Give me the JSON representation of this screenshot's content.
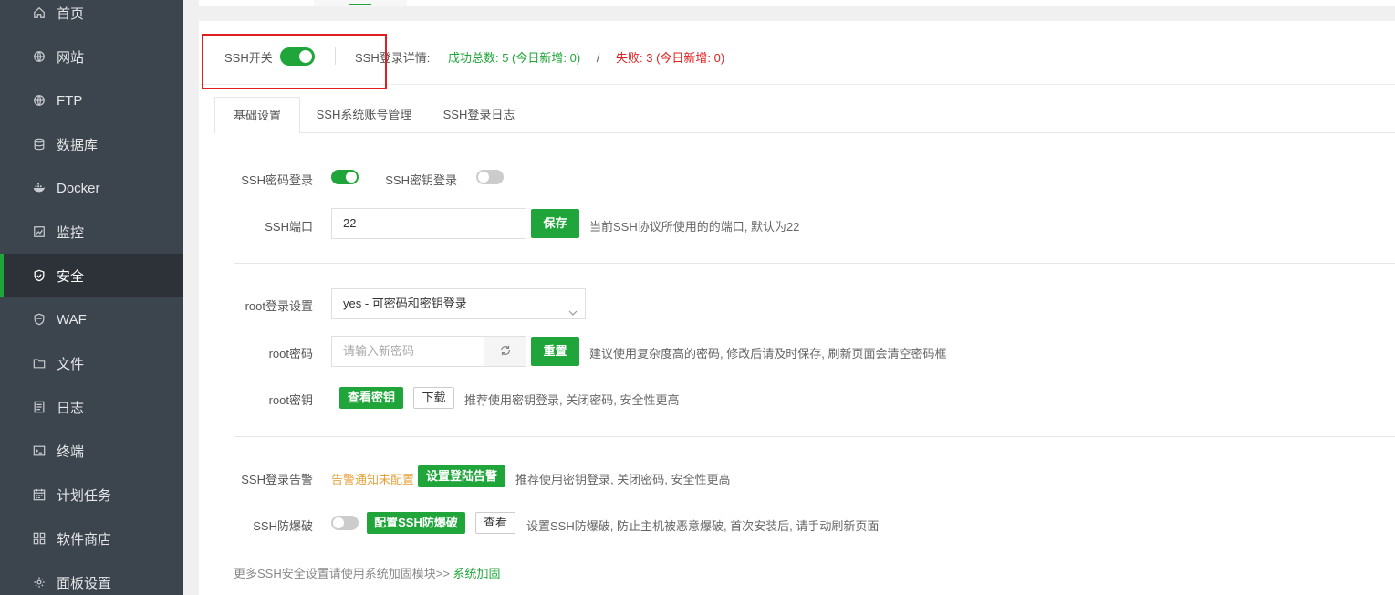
{
  "sidebar": {
    "items": [
      {
        "label": "首页",
        "icon": "home-icon"
      },
      {
        "label": "网站",
        "icon": "globe-icon"
      },
      {
        "label": "FTP",
        "icon": "globe-icon"
      },
      {
        "label": "数据库",
        "icon": "database-icon"
      },
      {
        "label": "Docker",
        "icon": "docker-icon"
      },
      {
        "label": "监控",
        "icon": "monitor-icon"
      },
      {
        "label": "安全",
        "icon": "shield-icon",
        "active": true
      },
      {
        "label": "WAF",
        "icon": "shield-icon"
      },
      {
        "label": "文件",
        "icon": "folder-icon"
      },
      {
        "label": "日志",
        "icon": "log-icon"
      },
      {
        "label": "终端",
        "icon": "terminal-icon"
      },
      {
        "label": "计划任务",
        "icon": "calendar-icon"
      },
      {
        "label": "软件商店",
        "icon": "grid-icon"
      },
      {
        "label": "面板设置",
        "icon": "gear-icon"
      }
    ]
  },
  "header": {
    "ssh_switch_label": "SSH开关",
    "ssh_switch_on": true,
    "detail_label": "SSH登录详情:",
    "success_text": "成功总数: 5 (今日新增: 0)",
    "separator": "/",
    "fail_text": "失败: 3 (今日新增: 0)"
  },
  "tabs": [
    {
      "label": "基础设置",
      "active": true
    },
    {
      "label": "SSH系统账号管理",
      "active": false
    },
    {
      "label": "SSH登录日志",
      "active": false
    }
  ],
  "form": {
    "password_login_label": "SSH密码登录",
    "password_login_on": true,
    "key_login_label": "SSH密钥登录",
    "key_login_on": false,
    "port_label": "SSH端口",
    "port_value": "22",
    "port_save": "保存",
    "port_hint": "当前SSH协议所使用的的端口, 默认为22",
    "root_login_label": "root登录设置",
    "root_login_value": "yes - 可密码和密钥登录",
    "root_pwd_label": "root密码",
    "root_pwd_placeholder": "请输入新密码",
    "root_pwd_reset": "重置",
    "root_pwd_hint": "建议使用复杂度高的密码, 修改后请及时保存, 刷新页面会清空密码框",
    "root_key_label": "root密钥",
    "root_key_view": "查看密钥",
    "root_key_download": "下载",
    "root_key_hint": "推荐使用密钥登录, 关闭密码, 安全性更高",
    "alarm_label": "SSH登录告警",
    "alarm_status": "告警通知未配置",
    "alarm_config": "设置登陆告警",
    "alarm_hint": "推荐使用密钥登录, 关闭密码, 安全性更高",
    "brute_label": "SSH防爆破",
    "brute_on": false,
    "brute_config": "配置SSH防爆破",
    "brute_view": "查看",
    "brute_hint": "设置SSH防爆破, 防止主机被恶意爆破, 首次安装后, 请手动刷新页面",
    "footer_text": "更多SSH安全设置请使用系统加固模块>> ",
    "footer_link": "系统加固"
  },
  "colors": {
    "accent": "#20a53a",
    "danger": "#e02020",
    "warning": "#e6a23c",
    "sidebar_bg": "#3c444d"
  }
}
